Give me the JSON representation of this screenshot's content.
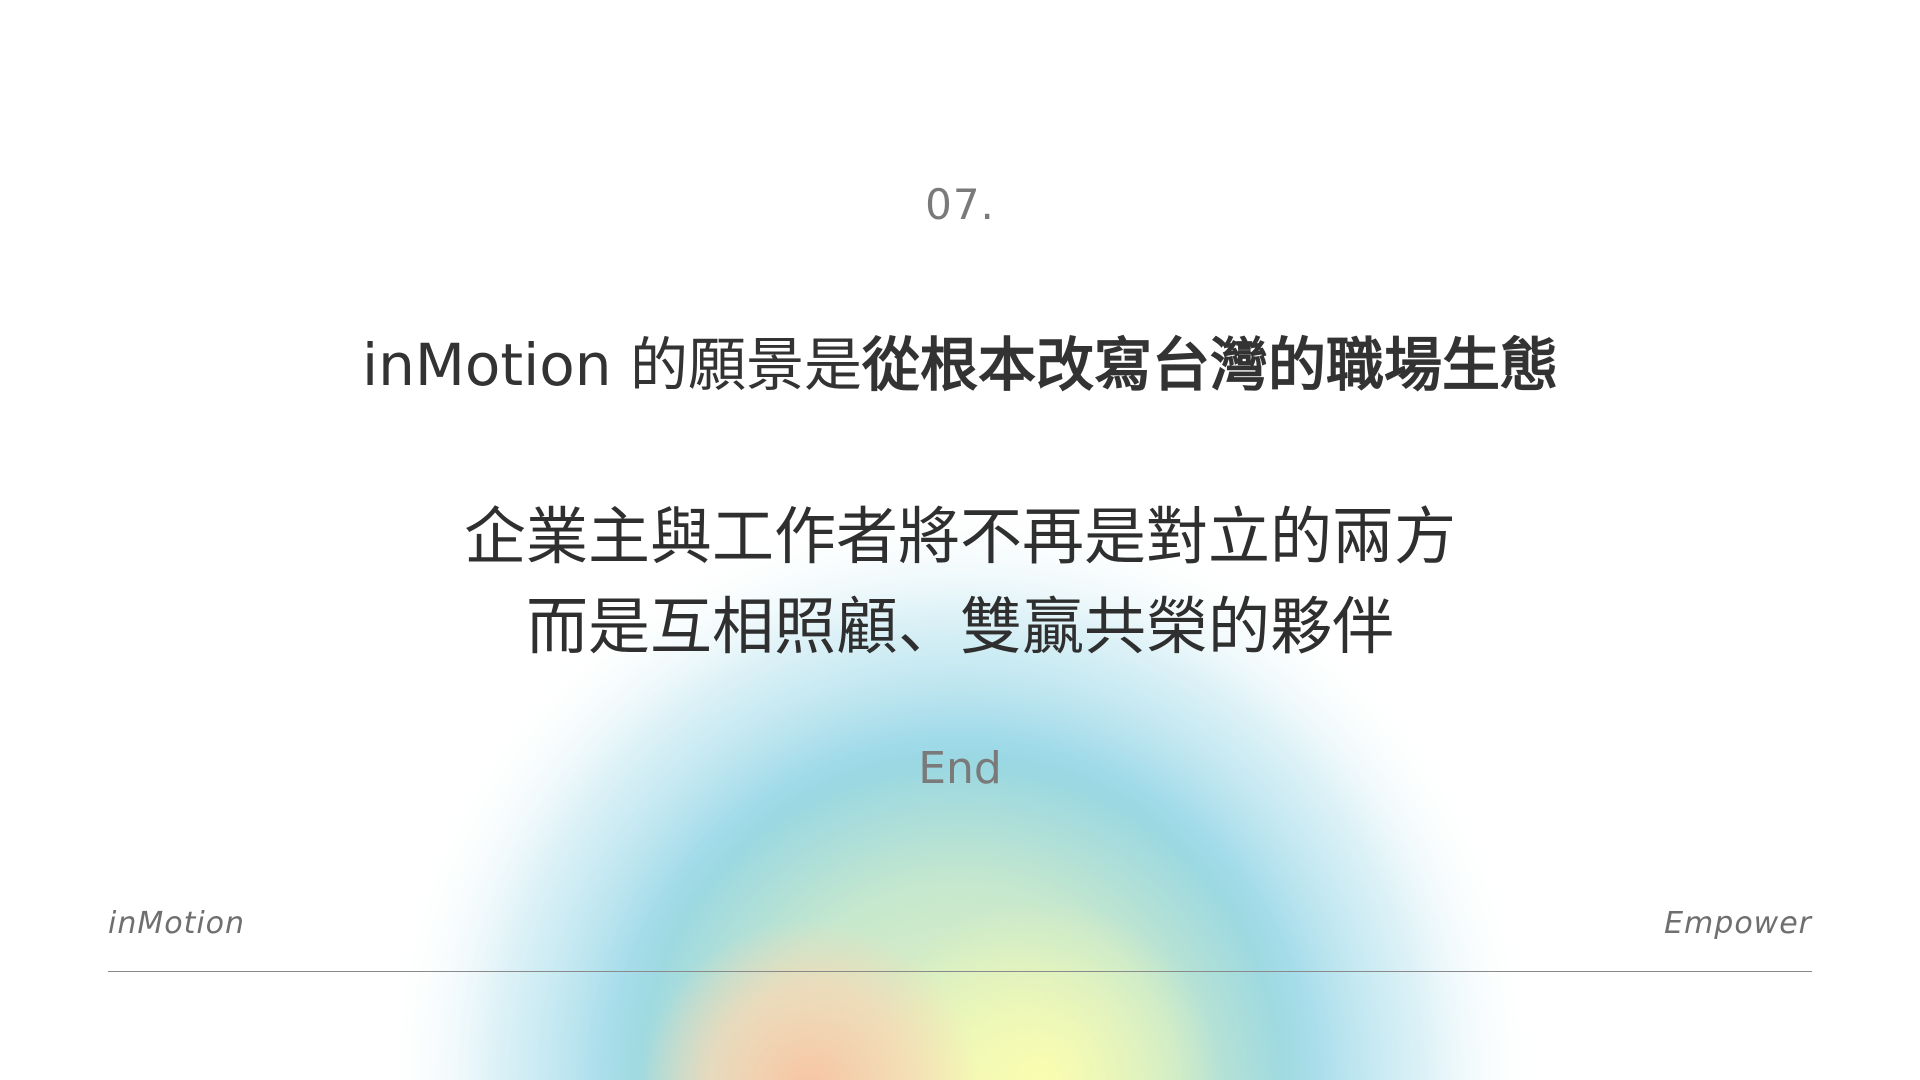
{
  "slide": {
    "section_number": "07.",
    "headline": {
      "regular": "inMotion 的願景是",
      "bold": "從根本改寫台灣的職場生態"
    },
    "statement": {
      "line1": "企業主與工作者將不再是對立的兩方",
      "line2": "而是互相照顧、雙贏共榮的夥伴"
    },
    "end_label": "End"
  },
  "footer": {
    "left_label": "inMotion",
    "right_label": "Empower"
  },
  "colors": {
    "background": "#ffffff",
    "text_primary": "#333333",
    "text_secondary": "#7a7a7a",
    "glow_blue": "#86d0e3",
    "glow_yellow": "#f5f7b0",
    "glow_peach": "#f8c9a6"
  }
}
